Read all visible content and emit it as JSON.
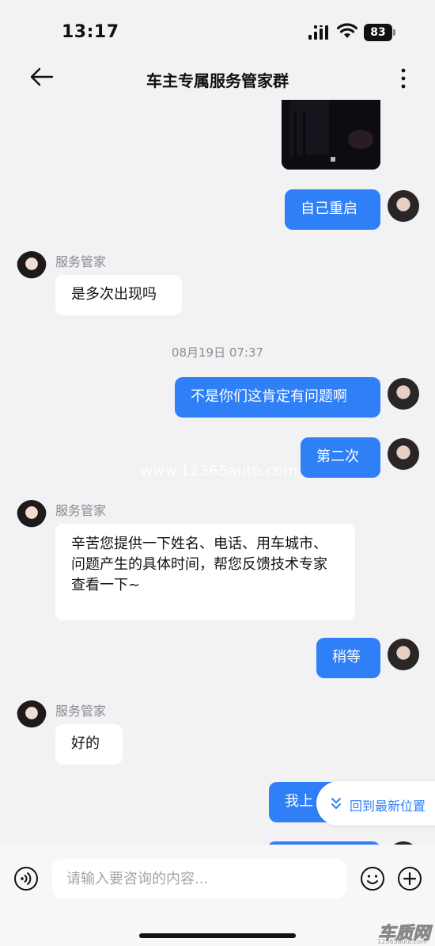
{
  "status_bar": {
    "time": "13:17",
    "battery": "83"
  },
  "nav": {
    "title": "车主专属服务管家群"
  },
  "messages": [
    {
      "id": "m1",
      "text": "自己重启"
    },
    {
      "id": "m2",
      "sender": "服务管家",
      "text": "是多次出现吗"
    },
    {
      "id": "ts1",
      "text": "08月19日 07:37"
    },
    {
      "id": "m3",
      "text": "不是你们这肯定有问题啊"
    },
    {
      "id": "m4",
      "text": "第二次"
    },
    {
      "id": "m5",
      "sender": "服务管家",
      "text": "辛苦您提供一下姓名、电话、用车城市、问题产生的具体时间，帮您反馈技术专家查看一下~"
    },
    {
      "id": "m6",
      "text": "稍等"
    },
    {
      "id": "m7",
      "sender": "服务管家",
      "text": "好的"
    },
    {
      "id": "m8",
      "text": "我上"
    }
  ],
  "watermark": "www.12365auto.com",
  "jump_latest": {
    "label": "回到最新位置"
  },
  "composer": {
    "placeholder": "请输入要咨询的内容..."
  },
  "brand": {
    "name": "车质网",
    "url": "12365auto.com"
  }
}
